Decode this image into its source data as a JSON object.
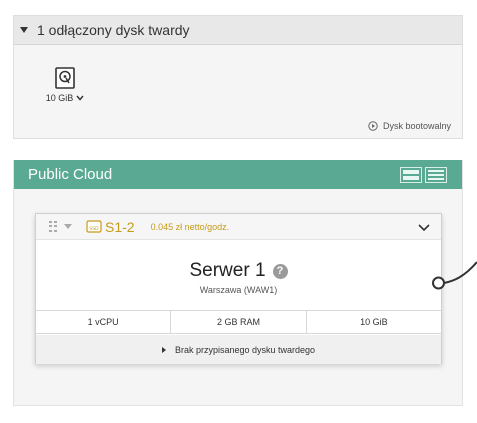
{
  "detached": {
    "title": "1 odłączony dysk twardy",
    "disk_size": "10 GiB",
    "boot_label": "Dysk bootowalny"
  },
  "cloud": {
    "title": "Public Cloud",
    "accent_color": "#5aaa93"
  },
  "server": {
    "plan": "S1-2",
    "price": "0.045 zł netto/godz.",
    "name": "Serwer 1",
    "help": "?",
    "location": "Warszawa (WAW1)",
    "specs": [
      "1 vCPU",
      "2 GB RAM",
      "10 GiB"
    ],
    "no_disk_label": "Brak przypisanego dysku twardego",
    "plan_color": "#c69b1b"
  }
}
